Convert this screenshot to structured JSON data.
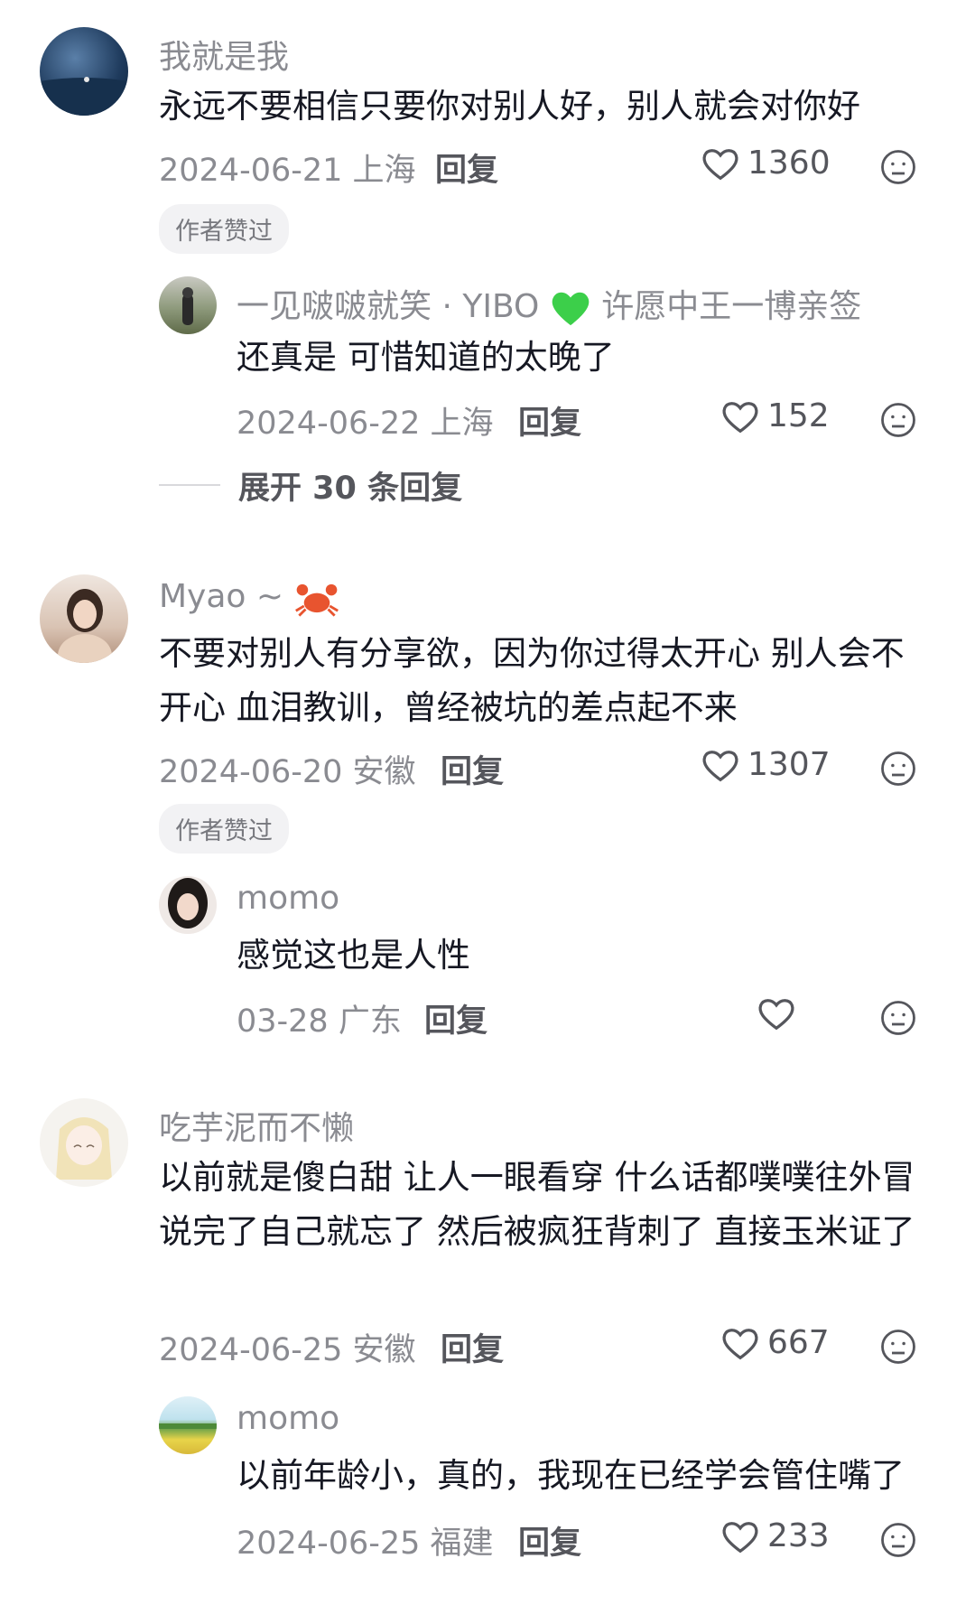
{
  "comments": [
    {
      "username": "我就是我",
      "text": "永远不要相信只要你对别人好，别人就会对你好",
      "date": "2024-06-21",
      "location": "上海",
      "reply_label": "回复",
      "likes": "1360",
      "badge": "作者赞过"
    },
    {
      "username": "一见啵啵就笑 · YIBO",
      "username_suffix": "许愿中王一博亲签",
      "text": "还真是 可惜知道的太晚了",
      "date": "2024-06-22",
      "location": "上海",
      "reply_label": "回复",
      "likes": "152"
    },
    {
      "expand_label": "展开 30 条回复"
    },
    {
      "username": "Myao ~",
      "text": "不要对别人有分享欲，因为你过得太开心 别人会不开心 血泪教训，曾经被坑的差点起不来",
      "date": "2024-06-20",
      "location": "安徽",
      "reply_label": "回复",
      "likes": "1307",
      "badge": "作者赞过"
    },
    {
      "username": "momo",
      "text": "感觉这也是人性",
      "date": "03-28",
      "location": "广东",
      "reply_label": "回复",
      "likes": ""
    },
    {
      "username": "吃芋泥而不懒",
      "text": "以前就是傻白甜 让人一眼看穿 什么话都噗噗往外冒 说完了自己就忘了 然后被疯狂背刺了 直接玉米证了",
      "date": "2024-06-25",
      "location": "安徽",
      "reply_label": "回复",
      "likes": "667"
    },
    {
      "username": "momo",
      "text": "以前年龄小，真的，我现在已经学会管住嘴了",
      "date": "2024-06-25",
      "location": "福建",
      "reply_label": "回复",
      "likes": "233"
    }
  ],
  "icons": {
    "like": "heart-outline-icon",
    "dislike": "frown-face-icon",
    "green_heart": "green-heart-emoji",
    "crab": "crab-emoji"
  },
  "colors": {
    "text": "#161823",
    "muted": "#8a8b91",
    "action": "#55565c",
    "badge_bg": "#f2f2f4"
  }
}
